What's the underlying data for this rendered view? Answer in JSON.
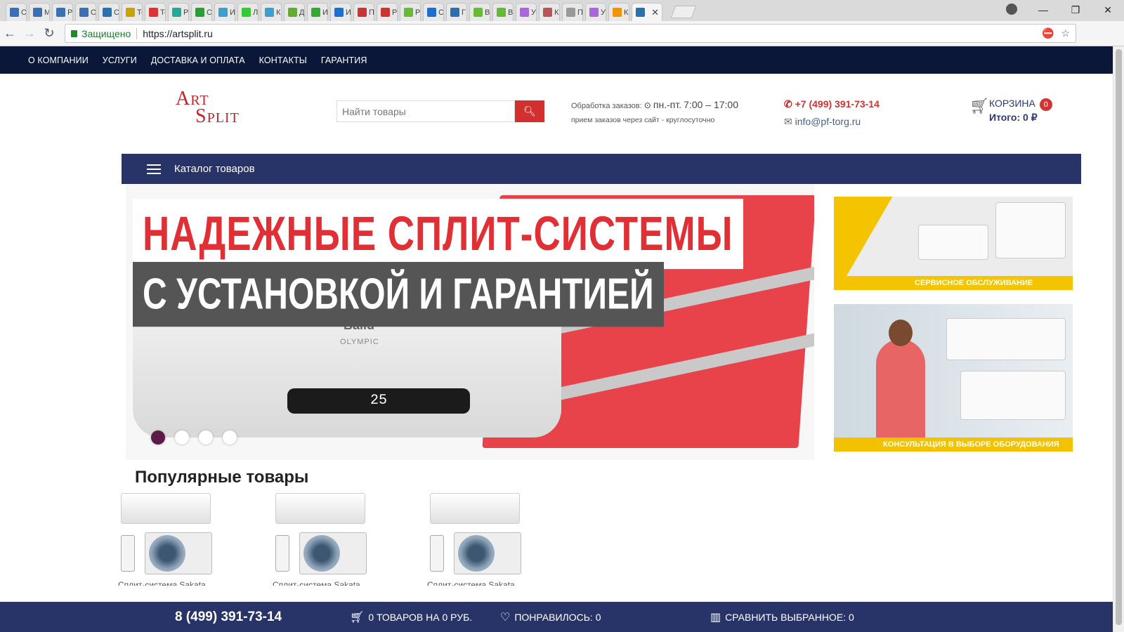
{
  "browser": {
    "tabs": [
      {
        "label": "О",
        "color": "#3b6fb6"
      },
      {
        "label": "М",
        "color": "#3b6fb6"
      },
      {
        "label": "Р",
        "color": "#3b6fb6"
      },
      {
        "label": "О",
        "color": "#3b6fb6"
      },
      {
        "label": "С",
        "color": "#2a6fb0"
      },
      {
        "label": "Тс",
        "color": "#c9a400"
      },
      {
        "label": "Тс",
        "color": "#d33"
      },
      {
        "label": "Р",
        "color": "#2a9"
      },
      {
        "label": "С",
        "color": "#2a9d3a"
      },
      {
        "label": "И",
        "color": "#3aa0d0"
      },
      {
        "label": "Л",
        "color": "#3c3"
      },
      {
        "label": "К",
        "color": "#3aa0d0"
      },
      {
        "label": "Д",
        "color": "#6a3"
      },
      {
        "label": "И",
        "color": "#3a3"
      },
      {
        "label": "И",
        "color": "#1a6fd0"
      },
      {
        "label": "П",
        "color": "#c33"
      },
      {
        "label": "Р",
        "color": "#c33"
      },
      {
        "label": "Р",
        "color": "#6b3"
      },
      {
        "label": "С",
        "color": "#1a6fd0"
      },
      {
        "label": "Г",
        "color": "#2a6fb0"
      },
      {
        "label": "В",
        "color": "#6b3"
      },
      {
        "label": "В",
        "color": "#6b3"
      },
      {
        "label": "У",
        "color": "#a6d"
      },
      {
        "label": "К",
        "color": "#b55"
      },
      {
        "label": "П",
        "color": "#999"
      },
      {
        "label": "У",
        "color": "#a6d"
      },
      {
        "label": "К",
        "color": "#f29400"
      }
    ],
    "active_tab_icon": "ruble-icon",
    "secure_label": "Защищено",
    "url": "https://artsplit.ru"
  },
  "topnav": [
    "О КОМПАНИИ",
    "УСЛУГИ",
    "ДОСТАВКА И ОПЛАТА",
    "КОНТАКТЫ",
    "ГАРАНТИЯ"
  ],
  "header": {
    "logo_line1": "Art",
    "logo_line2": "Split",
    "search_placeholder": "Найти товары",
    "hours_label": "Обработка заказов:",
    "hours_days": "пн.-пт.",
    "hours_time": "7:00 – 17:00",
    "hours_note": "прием заказов через сайт - круглосуточно",
    "phone": "+7 (499) 391-73-14",
    "email": "info@pf-torg.ru",
    "cart_label": "КОРЗИНА",
    "cart_count": "0",
    "cart_total": "Итого: 0 ₽"
  },
  "catalog_label": "Каталог товаров",
  "slider": {
    "headline1": "НАДЕЖНЫЕ СПЛИТ-СИСТЕМЫ",
    "headline2": "С УСТАНОВКОЙ И ГАРАНТИЕЙ",
    "brand": "Ballu",
    "model": "OLYMPIC",
    "display": "25",
    "dots": 4,
    "active_dot": 0
  },
  "promos": [
    {
      "label": "СЕРВИСНОЕ ОБСЛУЖИВАНИЕ"
    },
    {
      "label": "КОНСУЛЬТАЦИЯ В ВЫБОРЕ ОБОРУДОВАНИЯ"
    }
  ],
  "popular_title": "Популярные товары",
  "products": [
    {
      "caption": "Сплит-система Sakata"
    },
    {
      "caption": "Сплит-система Sakata"
    },
    {
      "caption": "Сплит-система Sakata"
    }
  ],
  "bottom": {
    "phone": "8 (499) 391-73-14",
    "cart_summary": "0 ТОВАРОВ НА 0 РУБ.",
    "liked": "ПОНРАВИЛОСЬ: 0",
    "compare": "СРАВНИТЬ ВЫБРАННОЕ: 0"
  }
}
